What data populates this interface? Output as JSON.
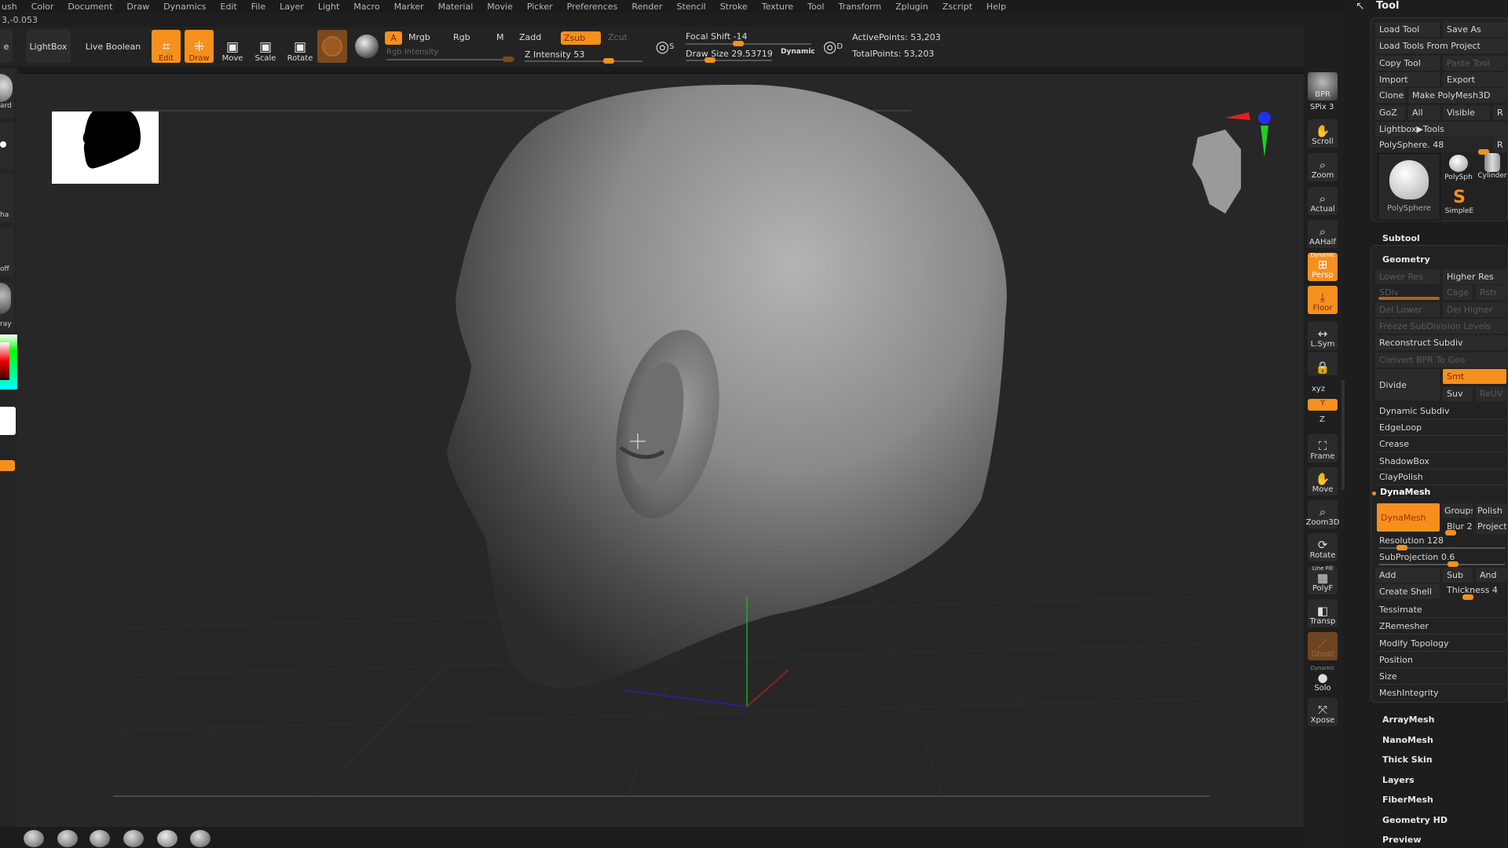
{
  "menu": [
    "ush",
    "Color",
    "Document",
    "Draw",
    "Dynamics",
    "Edit",
    "File",
    "Layer",
    "Light",
    "Macro",
    "Marker",
    "Material",
    "Movie",
    "Picker",
    "Preferences",
    "Render",
    "Stencil",
    "Stroke",
    "Texture",
    "Tool",
    "Transform",
    "Zplugin",
    "Zscript",
    "Help"
  ],
  "coord_readout": "3,-0.053",
  "toolbar": {
    "partial_button": "e",
    "lightbox": "LightBox",
    "live_boolean": "Live Boolean",
    "edit": "Edit",
    "draw": "Draw",
    "move": "Move",
    "scale": "Scale",
    "rotate": "Rotate",
    "a": "A",
    "mrgb": "Mrgb",
    "rgb": "Rgb",
    "m": "M",
    "zadd": "Zadd",
    "zsub": "Zsub",
    "zcut": "Zcut",
    "rgb_intensity": "Rgb Intensity",
    "z_intensity": "Z Intensity 53",
    "focal_shift": "Focal Shift -14",
    "draw_size": "Draw Size 29.53719",
    "dynamic": "Dynamic",
    "active_points": "ActivePoints: 53,203",
    "total_points": "TotalPoints: 53,203",
    "s_label": "S",
    "d_label": "D"
  },
  "left_strip": [
    "ard",
    "ha",
    "off",
    "ray"
  ],
  "shelf": [
    "BPR",
    "SPix 3",
    "Scroll",
    "Zoom",
    "Actual",
    "AAHalf",
    "Persp",
    "Floor",
    "L.Sym",
    "",
    "xyz",
    "Y",
    "Z",
    "Frame",
    "Move",
    "Zoom3D",
    "Rotate",
    "PolyF",
    "Transp",
    "Ghost",
    "Solo",
    "Xpose"
  ],
  "shelf_extra": {
    "dynamic_persp": "Dynamic",
    "line_fill": "Line Fill",
    "dynamic_solo": "Dynamic"
  },
  "panel": {
    "title": "Tool",
    "load_tool": "Load Tool",
    "save_as": "Save As",
    "load_from_project": "Load Tools From Project",
    "copy_tool": "Copy Tool",
    "paste_tool": "Paste Tool",
    "import": "Import",
    "export": "Export",
    "clone": "Clone",
    "make_polymesh": "Make PolyMesh3D",
    "goz": "GoZ",
    "all": "All",
    "visible": "Visible",
    "r": "R",
    "lightbox_tools": "Lightbox▶Tools",
    "current_tool": "PolySphere. 48",
    "thumbs": {
      "main": "PolySphere",
      "polysph": "PolySph",
      "cylinder": "Cylinder",
      "simple": "SimpleE"
    },
    "subtool": "Subtool",
    "geometry": "Geometry",
    "lower_res": "Lower Res",
    "higher_res": "Higher Res",
    "sdiv": "SDiv",
    "cage": "Cage",
    "rstr": "Rstr",
    "del_lower": "Del Lower",
    "del_higher": "Del Higher",
    "freeze": "Freeze SubDivision Levels",
    "reconstruct": "Reconstruct Subdiv",
    "convert_bpr": "Convert BPR To Geo",
    "divide": "Divide",
    "smt": "Smt",
    "suv": "Suv",
    "reuv": "ReUV",
    "items1": [
      "Dynamic Subdiv",
      "EdgeLoop",
      "Crease",
      "ShadowBox",
      "ClayPolish"
    ],
    "dynamesh_header": "DynaMesh",
    "dynamesh_button": "DynaMesh",
    "groups": "Groups",
    "polish": "Polish",
    "blur": "Blur 2",
    "project": "Project",
    "resolution": "Resolution 128",
    "subprojection": "SubProjection 0.6",
    "add": "Add",
    "sub": "Sub",
    "and": "And",
    "create_shell": "Create Shell",
    "thickness": "Thickness 4",
    "items2": [
      "Tessimate",
      "ZRemesher",
      "Modify Topology",
      "Position",
      "Size",
      "MeshIntegrity"
    ],
    "sections": [
      "ArrayMesh",
      "NanoMesh",
      "Thick Skin",
      "Layers",
      "FiberMesh",
      "Geometry HD",
      "Preview"
    ]
  },
  "colors": {
    "accent": "#f5901e",
    "background": "#1e1e1e",
    "button": "#2b2b2b"
  }
}
